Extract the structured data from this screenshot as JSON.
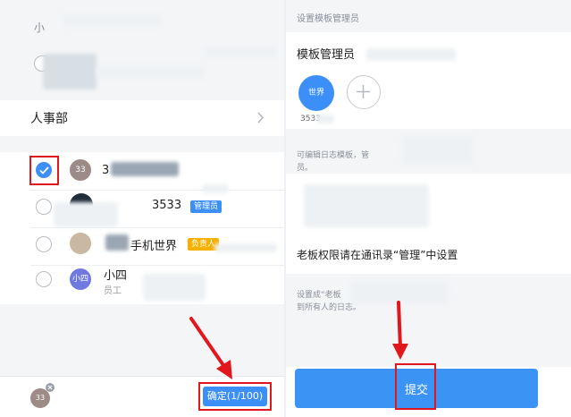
{
  "left": {
    "top_label": "小",
    "department": "人事部",
    "members": [
      {
        "avatar_text": "33",
        "name": "3",
        "checked": true
      },
      {
        "avatar_text": "",
        "name": "3533",
        "badge": "管理员",
        "checked": false
      },
      {
        "avatar_text": "",
        "name": "手机世界",
        "badge": "负责人",
        "checked": false
      },
      {
        "avatar_text": "小四",
        "name": "小四",
        "subtitle": "员工",
        "checked": false
      }
    ],
    "footer": {
      "avatar_text": "33",
      "confirm_label": "确定(1/100)"
    }
  },
  "right": {
    "header": "设置模板管理员",
    "admin_title": "模板管理员",
    "admin_avatar_text": "世界",
    "admin_caption": "3533",
    "desc_line1": "可编辑日志模板，管",
    "desc_line2": "员。",
    "boss_title": "老板权限请在通讯录“管理”中设置",
    "setting_line1": "设置成“老板",
    "setting_line2": "到所有人的日志。",
    "submit_label": "提交"
  },
  "colors": {
    "accent": "#3b8ff6",
    "annotation_red": "#e0171c",
    "badge_admin": "#3b8ff6",
    "badge_owner": "#f5b000"
  },
  "icons": [
    "checkmark-icon",
    "plus-icon",
    "chevron-right-icon",
    "remove-icon",
    "arrow-annotation-icon"
  ]
}
